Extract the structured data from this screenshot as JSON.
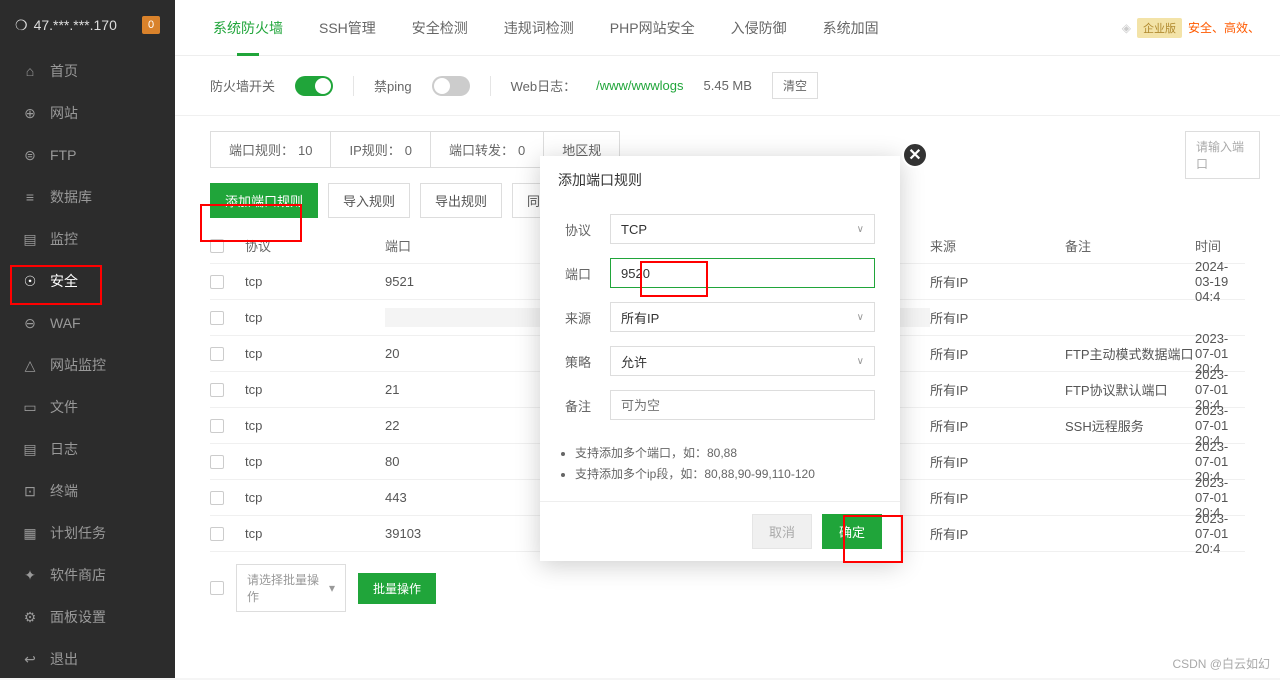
{
  "server_ip": "47.***.***.170",
  "notif_count": "0",
  "sidebar": {
    "items": [
      {
        "icon": "⌂",
        "label": "首页"
      },
      {
        "icon": "⊕",
        "label": "网站"
      },
      {
        "icon": "⊜",
        "label": "FTP"
      },
      {
        "icon": "≡",
        "label": "数据库"
      },
      {
        "icon": "▤",
        "label": "监控"
      },
      {
        "icon": "☉",
        "label": "安全"
      },
      {
        "icon": "⊖",
        "label": "WAF"
      },
      {
        "icon": "△",
        "label": "网站监控"
      },
      {
        "icon": "▭",
        "label": "文件"
      },
      {
        "icon": "▤",
        "label": "日志"
      },
      {
        "icon": "⊡",
        "label": "终端"
      },
      {
        "icon": "▦",
        "label": "计划任务"
      },
      {
        "icon": "✦",
        "label": "软件商店"
      },
      {
        "icon": "⚙",
        "label": "面板设置"
      },
      {
        "icon": "↩",
        "label": "退出"
      }
    ]
  },
  "tabs": [
    "系统防火墙",
    "SSH管理",
    "安全检测",
    "违规词检测",
    "PHP网站安全",
    "入侵防御",
    "系统加固"
  ],
  "ent_label": "企业版",
  "slogan": "安全、高效、",
  "toolbar": {
    "fw_label": "防火墙开关",
    "ping_label": "禁ping",
    "weblog_label": "Web日志：",
    "weblog_path": "/www/wwwlogs",
    "weblog_size": "5.45 MB",
    "clear_btn": "清空"
  },
  "subtabs": {
    "port": {
      "label": "端口规则：",
      "count": "10"
    },
    "ip": {
      "label": "IP规则：",
      "count": "0"
    },
    "fwd": {
      "label": "端口转发：",
      "count": "0"
    },
    "region": {
      "label": "地区规"
    }
  },
  "search_placeholder": "请输入端口",
  "actions": {
    "add": "添加端口规则",
    "import": "导入规则",
    "export": "导出规则",
    "sync": "同步端口配"
  },
  "columns": {
    "proto": "协议",
    "port": "端口",
    "source": "来源",
    "remark": "备注",
    "time": "时间"
  },
  "rows": [
    {
      "proto": "tcp",
      "port": "9521",
      "source": "所有IP",
      "remark": "",
      "time": "2024-03-19 04:4"
    },
    {
      "proto": "tcp",
      "port": "",
      "source": "所有IP",
      "remark": "",
      "time": "",
      "blurred": true
    },
    {
      "proto": "tcp",
      "port": "20",
      "source": "所有IP",
      "remark": "FTP主动模式数据端口",
      "time": "2023-07-01 20:4"
    },
    {
      "proto": "tcp",
      "port": "21",
      "source": "所有IP",
      "remark": "FTP协议默认端口",
      "time": "2023-07-01 20:4"
    },
    {
      "proto": "tcp",
      "port": "22",
      "source": "所有IP",
      "remark": "SSH远程服务",
      "time": "2023-07-01 20:4"
    },
    {
      "proto": "tcp",
      "port": "80",
      "source": "所有IP",
      "remark": "",
      "time": "2023-07-01 20:4"
    },
    {
      "proto": "tcp",
      "port": "443",
      "source": "所有IP",
      "remark": "",
      "time": "2023-07-01 20:4"
    },
    {
      "proto": "tcp",
      "port": "39103",
      "source": "所有IP",
      "remark": "",
      "time": "2023-07-01 20:4"
    }
  ],
  "batch": {
    "select": "请选择批量操作",
    "btn": "批量操作"
  },
  "modal": {
    "title": "添加端口规则",
    "protocol_label": "协议",
    "protocol_value": "TCP",
    "port_label": "端口",
    "port_value": "9520",
    "source_label": "来源",
    "source_value": "所有IP",
    "policy_label": "策略",
    "policy_value": "允许",
    "remark_label": "备注",
    "remark_placeholder": "可为空",
    "tip1": "支持添加多个端口，如：80,88",
    "tip2": "支持添加多个ip段，如：80,88,90-99,110-120",
    "cancel": "取消",
    "confirm": "确定"
  },
  "watermark": "CSDN @白云如幻"
}
